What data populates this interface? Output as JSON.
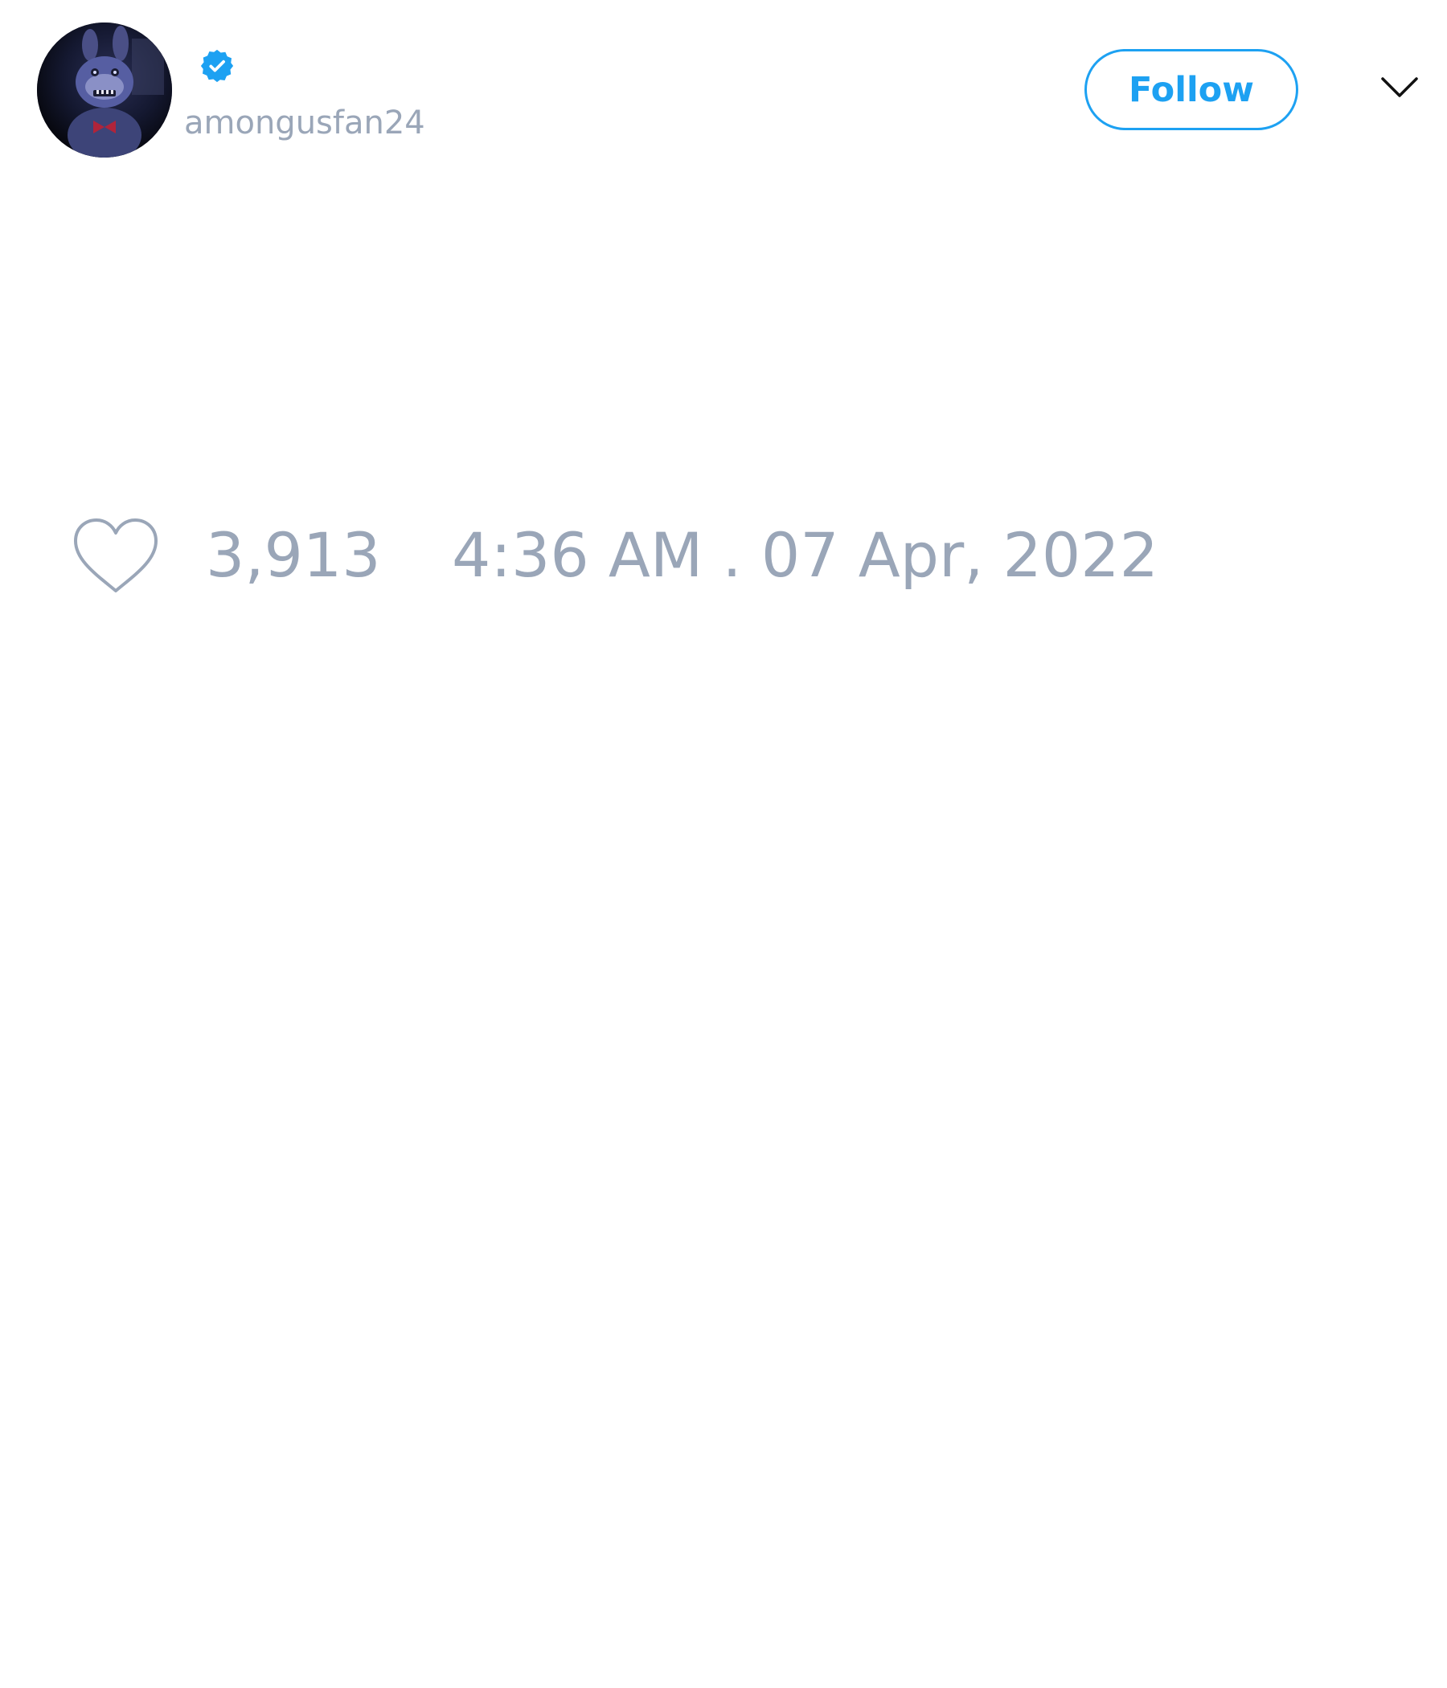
{
  "tweet": {
    "author": {
      "handle": "amongusfan24",
      "verified": true,
      "avatar_icon": "animatronic-avatar"
    },
    "follow_label": "Follow",
    "likes": "3,913",
    "timestamp": "4:36 AM . 07 Apr, 2022"
  },
  "icons": {
    "verified": "verified-badge-icon",
    "menu": "chevron-down-icon",
    "like": "heart-outline-icon"
  },
  "colors": {
    "accent": "#1da1f2",
    "muted_text": "#9aa6b8",
    "background": "#ffffff"
  }
}
